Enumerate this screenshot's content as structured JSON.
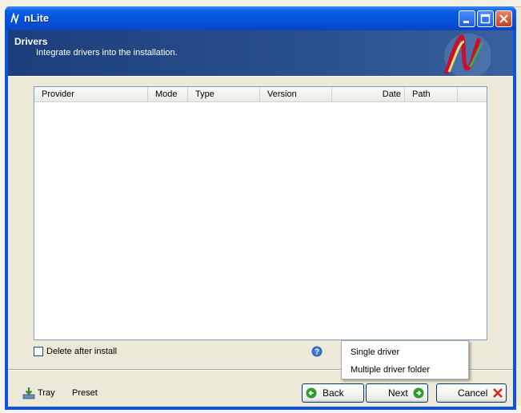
{
  "window": {
    "title": "nLite"
  },
  "header": {
    "title": "Drivers",
    "subtitle": "Integrate drivers into the installation."
  },
  "driver_list": {
    "columns": [
      "Provider",
      "Mode",
      "Type",
      "Version",
      "Date",
      "Path"
    ],
    "rows": []
  },
  "options": {
    "delete_after_install_label": "Delete after install",
    "delete_after_install_checked": false
  },
  "insert_menu": {
    "items": [
      "Single driver",
      "Multiple driver folder"
    ]
  },
  "footer": {
    "tray_label": "Tray",
    "preset_label": "Preset",
    "back_label": "Back",
    "next_label": "Next",
    "cancel_label": "Cancel"
  },
  "colors": {
    "titlebar": "#0a54e0",
    "header_band": "#2a4f8f",
    "dialog_bg": "#ece9d8"
  },
  "icons": {
    "app": "nlite-logo-icon",
    "help": "help-icon",
    "back": "arrow-left-icon",
    "next": "arrow-right-icon",
    "cancel": "red-x-icon",
    "tray": "tray-down-arrow-icon"
  }
}
